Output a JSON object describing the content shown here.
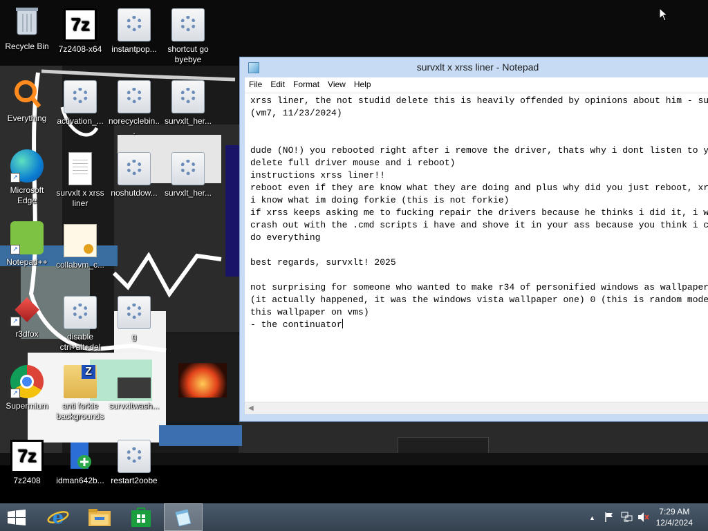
{
  "desktop": {
    "icons": [
      {
        "label": "Recycle Bin"
      },
      {
        "label": "7z2408-x64"
      },
      {
        "label": "instantpop..."
      },
      {
        "label": "shortcut go byebye"
      },
      {
        "label": "Everything"
      },
      {
        "label": "activation_..."
      },
      {
        "label": "norecyclebin..."
      },
      {
        "label": "survxlt_her..."
      },
      {
        "label": "Microsoft Edge"
      },
      {
        "label": "survxlt x xrss liner"
      },
      {
        "label": "noshutdow..."
      },
      {
        "label": "survxlt_her..."
      },
      {
        "label": "Notepad++"
      },
      {
        "label": "collabvm_c..."
      },
      {
        "label": "r3dfox"
      },
      {
        "label": "disable ctrl+alt+del"
      },
      {
        "label": "g"
      },
      {
        "label": "Supermium"
      },
      {
        "label": "anti forkie backgrounds"
      },
      {
        "label": "survxltwash..."
      },
      {
        "label": "7z2408"
      },
      {
        "label": "idman642b..."
      },
      {
        "label": "restart2oobe"
      }
    ]
  },
  "notepad": {
    "title": "survxlt x xrss liner - Notepad",
    "menu": [
      "File",
      "Edit",
      "Format",
      "View",
      "Help"
    ],
    "content": "xrss liner, the not studid delete this is heavily offended by opinions about him - survxlt\n(vm7, 11/23/2024)\n\n\ndude (NO!) you rebooted right after i remove the driver, thats why i dont listen to you, you\ndelete full driver mouse and i reboot)\ninstructions xrss liner!!\nreboot even if they are know what they are doing and plus why did you just reboot, xrss\ni know what im doing forkie (this is not forkie)\nif xrss keeps asking me to fucking repair the drivers because he thinks i did it, i will\ncrash out with the .cmd scripts i have and shove it in your ass because you think i can\ndo everything\n\nbest regards, survxlt! 2025\n\nnot surprising for someone who wanted to make r34 of personified windows as wallpaper\n(it actually happened, it was the windows vista wallpaper one) 0 (this is random mode\nthis wallpaper on vms)\n- the continuator"
  },
  "taskbar": {
    "time": "7:29 AM",
    "date": "12/4/2024"
  },
  "colors": {
    "taskbar": "#3c4a5a",
    "notepad_frame": "#c7dcf4"
  }
}
